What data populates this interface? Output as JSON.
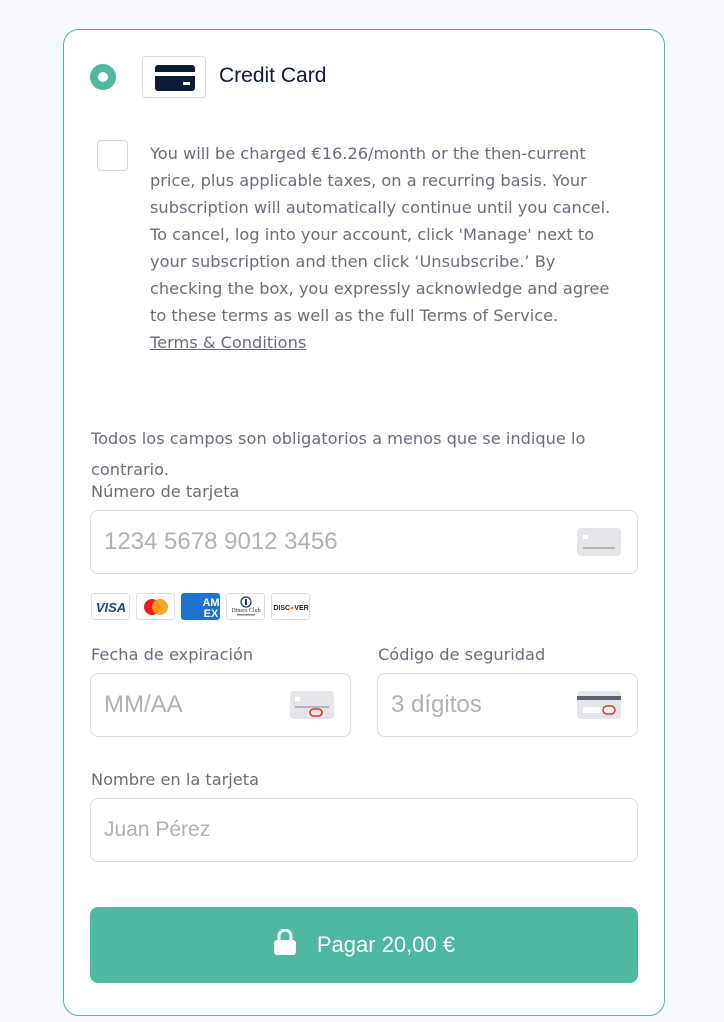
{
  "payment_method": {
    "label": "Credit Card",
    "selected": true,
    "icon": "credit-card-icon"
  },
  "subscription_terms": {
    "checked": false,
    "text": "You will be charged €16.26/month or the then-current price, plus applicable taxes, on a recurring basis. Your subscription will automatically continue until you cancel. To cancel, log into your account, click 'Manage' next to your subscription and then click ‘Unsubscribe.’ By checking the box, you expressly acknowledge and agree to these terms as well as the full Terms of Service.",
    "link_label": "Terms & Conditions"
  },
  "form": {
    "required_note": "Todos los campos son obligatorios a menos que se indique lo contrario.",
    "card_number": {
      "label": "Número de tarjeta",
      "placeholder": "1234 5678 9012 3456",
      "value": ""
    },
    "card_brands": [
      "Visa",
      "Mastercard",
      "American Express",
      "Diners Club International",
      "Discover"
    ],
    "expiry": {
      "label": "Fecha de expiración",
      "placeholder": "MM/AA",
      "value": ""
    },
    "security_code": {
      "label": "Código de seguridad",
      "placeholder": "3 dígitos",
      "value": ""
    },
    "cardholder": {
      "label": "Nombre en la tarjeta",
      "placeholder": "Juan Pérez",
      "value": ""
    }
  },
  "submit": {
    "label": "Pagar 20,00 €",
    "icon": "lock-icon"
  },
  "colors": {
    "accent": "#4fb8a1",
    "text_dark": "#0d1a33",
    "text_muted": "#6b6d7d",
    "error_red": "#e0352b"
  }
}
